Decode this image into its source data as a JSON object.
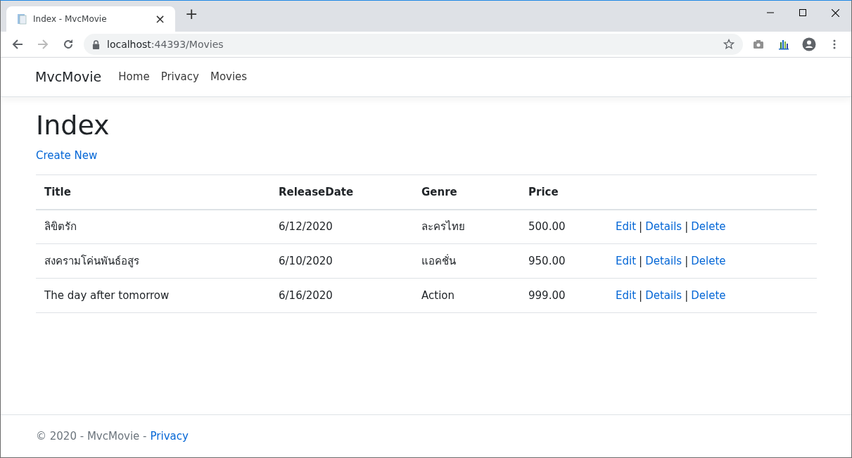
{
  "browser": {
    "tab": {
      "title": "Index - MvcMovie",
      "close": "×",
      "selected": true
    },
    "new_tab": "+",
    "url_host": "localhost",
    "url_path": ":44393/Movies"
  },
  "navbar": {
    "brand": "MvcMovie",
    "links": [
      "Home",
      "Privacy",
      "Movies"
    ]
  },
  "heading": "Index",
  "create_link": "Create New",
  "table": {
    "columns": [
      "Title",
      "ReleaseDate",
      "Genre",
      "Price",
      ""
    ],
    "rows": [
      {
        "cells": [
          "ลิขิตรัก",
          "6/12/2020",
          "ละครไทย",
          "500.00"
        ],
        "actions": [
          {
            "kind": "link",
            "text": "Edit"
          },
          {
            "kind": "separator",
            "text": "|"
          },
          {
            "kind": "link",
            "text": "Details"
          },
          {
            "kind": "separator",
            "text": "|"
          },
          {
            "kind": "link",
            "text": "Delete"
          }
        ]
      },
      {
        "cells": [
          "สงครามโค่นพันธ์อสูร",
          "6/10/2020",
          "แอคชั่น",
          "950.00"
        ],
        "actions": [
          {
            "kind": "link",
            "text": "Edit"
          },
          {
            "kind": "separator",
            "text": "|"
          },
          {
            "kind": "link",
            "text": "Details"
          },
          {
            "kind": "separator",
            "text": "|"
          },
          {
            "kind": "link",
            "text": "Delete"
          }
        ]
      },
      {
        "cells": [
          "The day after tomorrow",
          "6/16/2020",
          "Action",
          "999.00"
        ],
        "actions": [
          {
            "kind": "link",
            "text": "Edit"
          },
          {
            "kind": "separator",
            "text": "|"
          },
          {
            "kind": "link",
            "text": "Details"
          },
          {
            "kind": "separator",
            "text": "|"
          },
          {
            "kind": "link",
            "text": "Delete"
          }
        ]
      }
    ]
  },
  "footer": {
    "text": "© 2020 - MvcMovie -",
    "link": "Privacy"
  }
}
